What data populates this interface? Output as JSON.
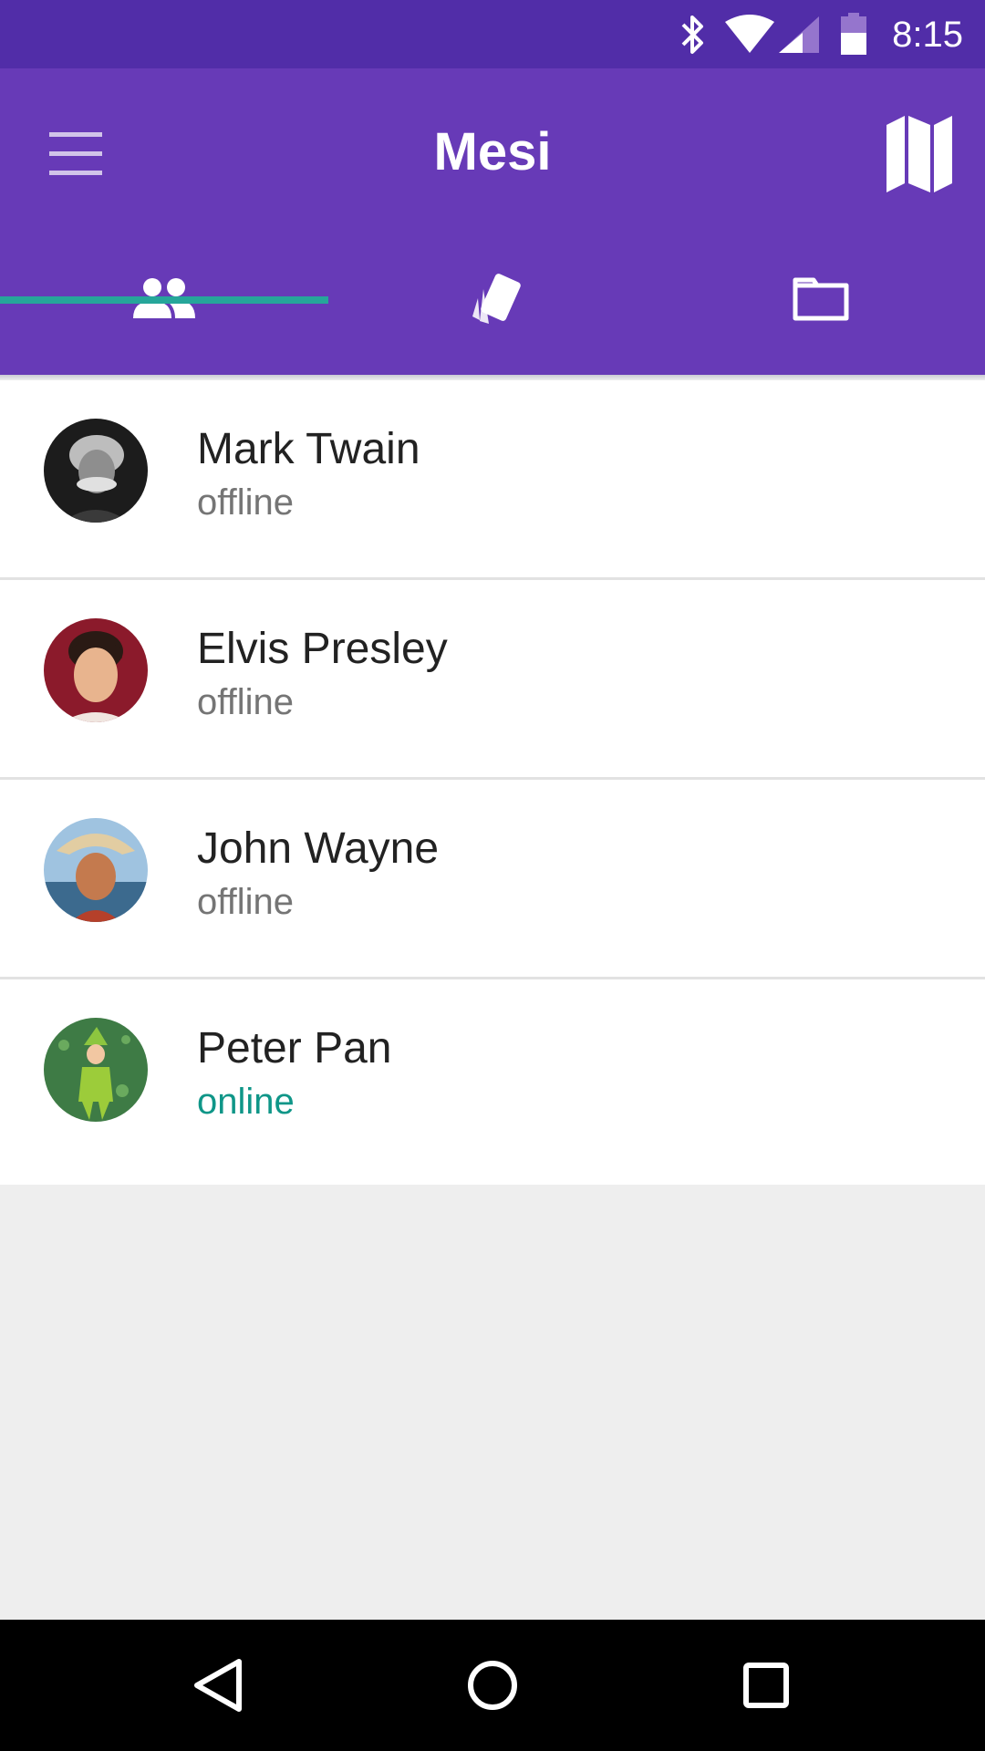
{
  "status_bar": {
    "time": "8:15",
    "icons": [
      "bluetooth-icon",
      "wifi-icon",
      "cellular-icon",
      "battery-icon"
    ]
  },
  "app_bar": {
    "title": "Mesi",
    "menu_icon": "hamburger-icon",
    "action_icon": "map-icon",
    "color": "#673ab7"
  },
  "tabs": [
    {
      "icon": "people-icon",
      "selected": true
    },
    {
      "icon": "cards-icon",
      "selected": false
    },
    {
      "icon": "folder-icon",
      "selected": false
    }
  ],
  "contacts": [
    {
      "name": "Mark Twain",
      "status": "offline"
    },
    {
      "name": "Elvis Presley",
      "status": "offline"
    },
    {
      "name": "John Wayne",
      "status": "offline"
    },
    {
      "name": "Peter Pan",
      "status": "online"
    }
  ],
  "colors": {
    "status_bar": "#512da8",
    "primary": "#673ab7",
    "accent": "#26a69a",
    "online": "#0f9688"
  },
  "nav_bar": {
    "icons": [
      "back-icon",
      "home-icon",
      "recents-icon"
    ]
  }
}
